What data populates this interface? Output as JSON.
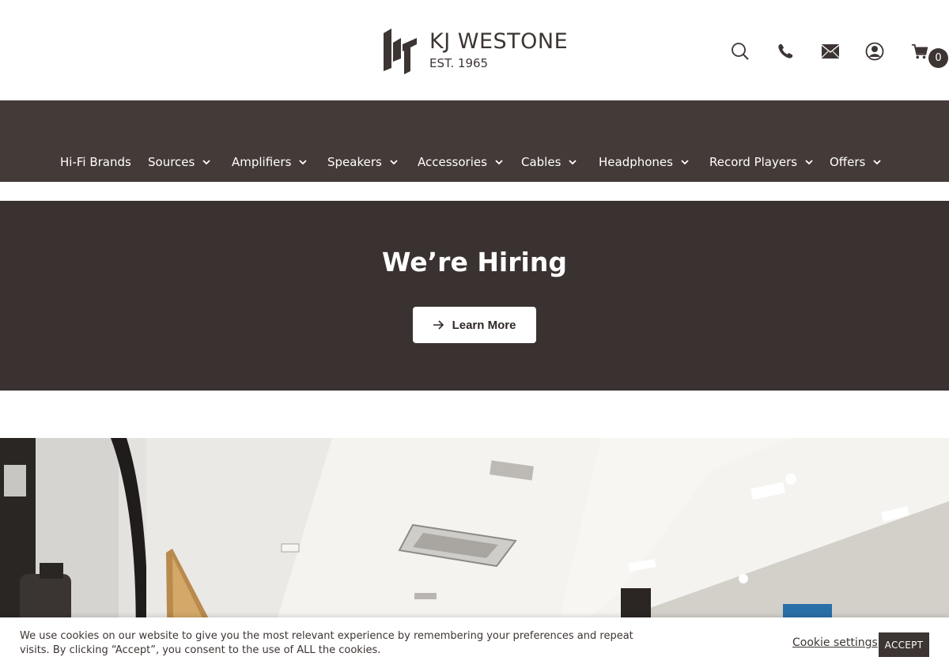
{
  "brand": {
    "name": "KJ WESTONE",
    "established": "EST. 1965"
  },
  "header": {
    "icons": [
      "search-icon",
      "phone-icon",
      "mail-icon",
      "account-icon",
      "cart-icon"
    ],
    "cart_count": "0"
  },
  "nav": {
    "items": [
      {
        "label": "Hi-Fi Brands",
        "has_dropdown": false
      },
      {
        "label": "Sources",
        "has_dropdown": true
      },
      {
        "label": "Amplifiers",
        "has_dropdown": true
      },
      {
        "label": "Speakers",
        "has_dropdown": true
      },
      {
        "label": "Accessories",
        "has_dropdown": true
      },
      {
        "label": "Cables",
        "has_dropdown": true
      },
      {
        "label": "Headphones",
        "has_dropdown": true
      },
      {
        "label": "Record Players",
        "has_dropdown": true
      },
      {
        "label": "Offers",
        "has_dropdown": true
      }
    ]
  },
  "hero": {
    "title": "We’re Hiring",
    "button_label": "Learn More"
  },
  "cookie_bar": {
    "message": "We use cookies on our website to give you the most relevant experience by remembering your preferences and repeat visits. By clicking “Accept”, you consent to the use of ALL the cookies.",
    "settings_label": "Cookie settings",
    "accept_label": "ACCEPT"
  },
  "colors": {
    "nav_bg": "#443a38",
    "hero_bg": "#3a3230",
    "text_dark": "#3d3533"
  }
}
